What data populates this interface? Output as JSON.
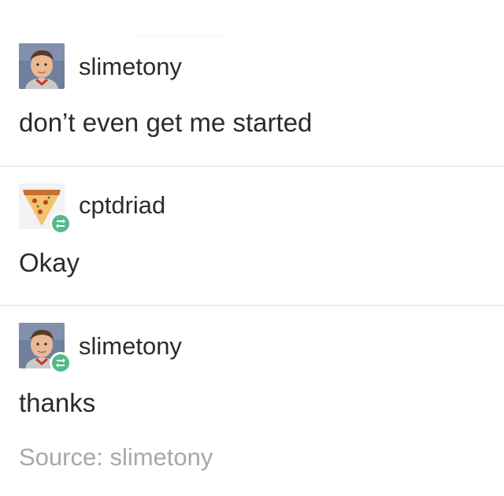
{
  "posts": [
    {
      "username": "slimetony",
      "text": "don’t even get me started",
      "avatar_icon": "boy-portrait-icon",
      "reblog": false
    },
    {
      "username": "cptdriad",
      "text": "Okay",
      "avatar_icon": "pizza-slice-icon",
      "reblog": true
    },
    {
      "username": "slimetony",
      "text": "thanks",
      "avatar_icon": "boy-portrait-icon",
      "reblog": true
    }
  ],
  "source": {
    "label": "Source: slimetony"
  },
  "colors": {
    "text": "#2b2b2b",
    "muted": "#a8a8a8",
    "reblog_badge": "#56b98a",
    "divider": "#ececec"
  }
}
